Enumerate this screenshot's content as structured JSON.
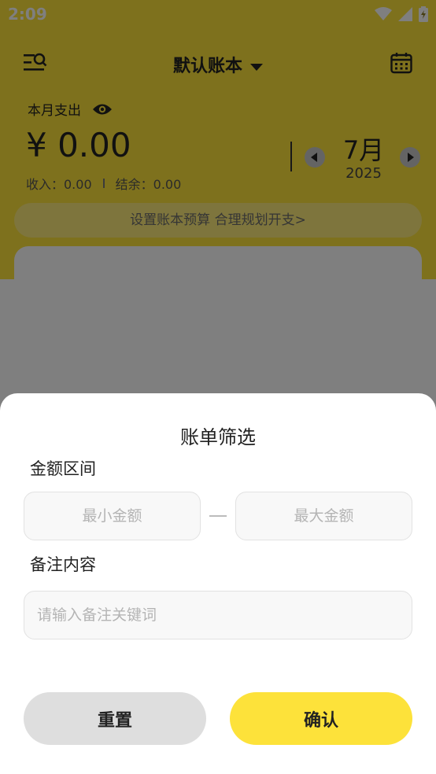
{
  "status_bar": {
    "time": "2:09"
  },
  "header": {
    "book_name": "默认账本"
  },
  "summary": {
    "month_label": "本月支出",
    "amount": "¥ 0.00",
    "income": "收入：0.00",
    "balance": "结余：0.00"
  },
  "month_nav": {
    "month": "7月",
    "year": "2025"
  },
  "budget_banner": "设置账本预算 合理规划开支>",
  "filter_sheet": {
    "title": "账单筛选",
    "amount_section": "金额区间",
    "min_placeholder": "最小金额",
    "max_placeholder": "最大金额",
    "note_section": "备注内容",
    "note_placeholder": "请输入备注关键词",
    "reset_label": "重置",
    "confirm_label": "确认"
  },
  "colors": {
    "accent": "#FDE23A",
    "reset_bg": "#DEDEDE",
    "overlay": "rgba(0,0,0,0.5)"
  },
  "icons": [
    "wifi-icon",
    "signal-icon",
    "battery-icon",
    "menu-search-icon",
    "caret-down-icon",
    "calendar-icon",
    "eye-icon",
    "chevron-left-icon",
    "chevron-right-icon"
  ]
}
